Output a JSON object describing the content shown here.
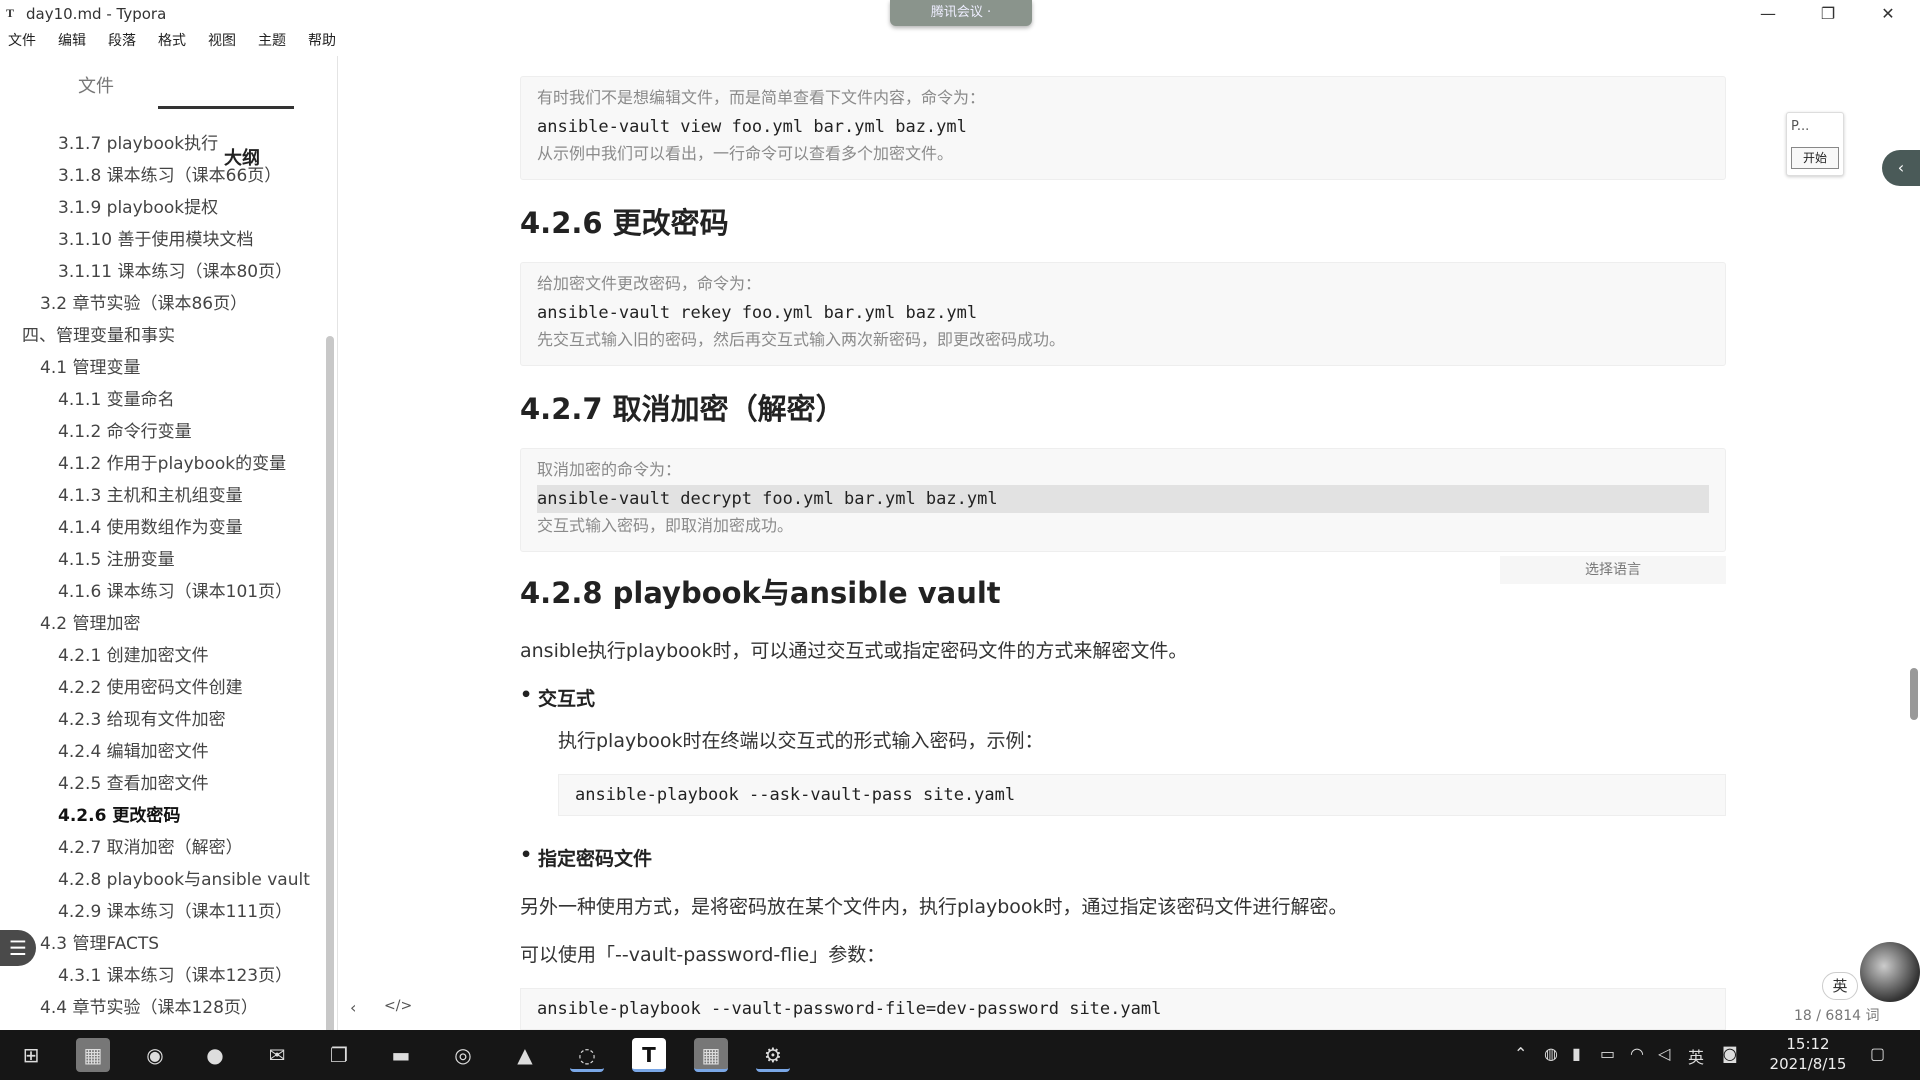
{
  "window": {
    "app_icon": "T",
    "title": "day10.md - Typora",
    "meeting_label": "腾讯会议 ·",
    "minimize": "—",
    "maximize": "❐",
    "close": "✕"
  },
  "menu": [
    "文件",
    "编辑",
    "段落",
    "格式",
    "视图",
    "主题",
    "帮助"
  ],
  "sidebar": {
    "tab_files": "文件",
    "tab_outline": "大纲",
    "items": [
      {
        "level": 3,
        "label": "3.1.7 playbook执行"
      },
      {
        "level": 3,
        "label": "3.1.8 课本练习（课本66页）"
      },
      {
        "level": 3,
        "label": "3.1.9 playbook提权"
      },
      {
        "level": 3,
        "label": "3.1.10 善于使用模块文档"
      },
      {
        "level": 3,
        "label": "3.1.11 课本练习（课本80页）"
      },
      {
        "level": 2,
        "label": "3.2 章节实验（课本86页）"
      },
      {
        "level": 1,
        "label": "四、管理变量和事实"
      },
      {
        "level": 2,
        "label": "4.1 管理变量"
      },
      {
        "level": 3,
        "label": "4.1.1 变量命名"
      },
      {
        "level": 3,
        "label": "4.1.2 命令行变量"
      },
      {
        "level": 3,
        "label": "4.1.2 作用于playbook的变量"
      },
      {
        "level": 3,
        "label": "4.1.3 主机和主机组变量"
      },
      {
        "level": 3,
        "label": "4.1.4 使用数组作为变量"
      },
      {
        "level": 3,
        "label": "4.1.5 注册变量"
      },
      {
        "level": 3,
        "label": "4.1.6 课本练习（课本101页）"
      },
      {
        "level": 2,
        "label": "4.2 管理加密"
      },
      {
        "level": 3,
        "label": "4.2.1 创建加密文件"
      },
      {
        "level": 3,
        "label": "4.2.2 使用密码文件创建"
      },
      {
        "level": 3,
        "label": "4.2.3 给现有文件加密"
      },
      {
        "level": 3,
        "label": "4.2.4 编辑加密文件"
      },
      {
        "level": 3,
        "label": "4.2.5 查看加密文件"
      },
      {
        "level": 3,
        "label": "4.2.6 更改密码",
        "active": true
      },
      {
        "level": 3,
        "label": "4.2.7 取消加密（解密）"
      },
      {
        "level": 3,
        "label": "4.2.8 playbook与ansible vault"
      },
      {
        "level": 3,
        "label": "4.2.9 课本练习（课本111页）"
      },
      {
        "level": 2,
        "label": "4.3 管理FACTS"
      },
      {
        "level": 3,
        "label": "4.3.1 课本练习（课本123页）"
      },
      {
        "level": 2,
        "label": "4.4 章节实验（课本128页）"
      }
    ],
    "nav_back": "‹",
    "nav_source": "</>"
  },
  "content": {
    "block1": {
      "note1": "有时我们不是想编辑文件，而是简单查看下文件内容，命令为：",
      "code": "ansible-vault view foo.yml bar.yml baz.yml",
      "note2": "从示例中我们可以看出，一行命令可以查看多个加密文件。"
    },
    "h_426": "4.2.6 更改密码",
    "block2": {
      "note1": "给加密文件更改密码，命令为：",
      "code": "ansible-vault rekey foo.yml bar.yml baz.yml",
      "note2": "先交互式输入旧的密码，然后再交互式输入两次新密码，即更改密码成功。"
    },
    "h_427": "4.2.7 取消加密（解密）",
    "block3": {
      "note1": "取消加密的命令为：",
      "code_a": "ansible-vault decrypt foo.yml bar.yml baz.yml",
      "note2": "交互式输入密码，即取消加密成功。"
    },
    "lang_select": "选择语言",
    "h_428": "4.2.8 playbook与ansible vault",
    "p1": "ansible执行playbook时，可以通过交互式或指定密码文件的方式来解密文件。",
    "bullet1": "交互式",
    "bullet1_text": "执行playbook时在终端以交互式的形式输入密码，示例：",
    "code4": "ansible-playbook --ask-vault-pass site.yaml",
    "bullet2": "指定密码文件",
    "p2": "另外一种使用方式，是将密码放在某个文件内，执行playbook时，通过指定该密码文件进行解密。",
    "p3": "可以使用「--vault-password-flie」参数：",
    "code5": "ansible-playbook --vault-password-file=dev-password site.yaml"
  },
  "widget": {
    "top": "P...",
    "button": "开始"
  },
  "ime": "英",
  "word_count": "18 / 6814 词",
  "taskbar": {
    "icons": [
      "windows-icon",
      "app1-icon",
      "vivaldi-icon",
      "media-icon",
      "wechat-icon",
      "window-icon",
      "folder-icon",
      "browser-icon",
      "photos-icon",
      "netease-icon",
      "typora-icon",
      "app2-icon",
      "network-app-icon"
    ],
    "tray_lang": "英",
    "time": "15:12",
    "date": "2021/8/15"
  }
}
